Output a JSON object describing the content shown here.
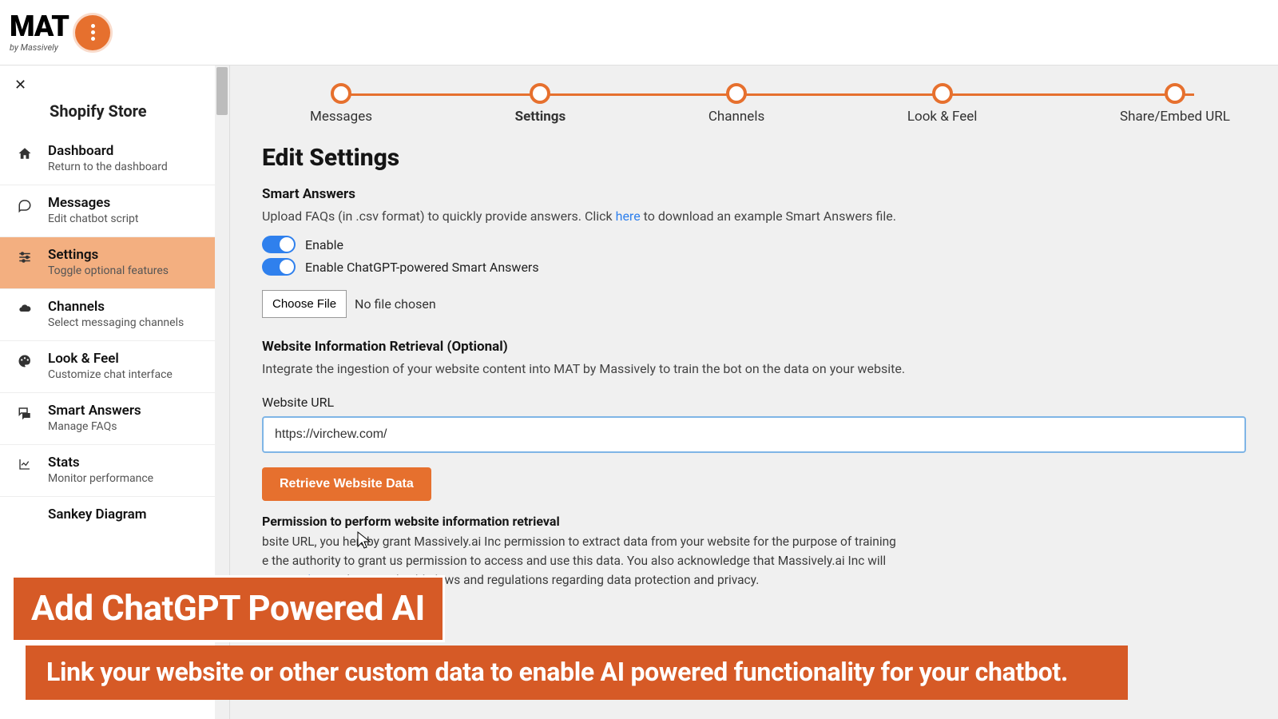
{
  "logo": {
    "main": "MAT",
    "sub": "by Massively"
  },
  "sidebar": {
    "store_title": "Shopify Store",
    "items": [
      {
        "title": "Dashboard",
        "sub": "Return to the dashboard"
      },
      {
        "title": "Messages",
        "sub": "Edit chatbot script"
      },
      {
        "title": "Settings",
        "sub": "Toggle optional features"
      },
      {
        "title": "Channels",
        "sub": "Select messaging channels"
      },
      {
        "title": "Look & Feel",
        "sub": "Customize chat interface"
      },
      {
        "title": "Smart Answers",
        "sub": "Manage FAQs"
      },
      {
        "title": "Stats",
        "sub": "Monitor performance"
      },
      {
        "title": "Sankey Diagram",
        "sub": ""
      }
    ]
  },
  "stepper": [
    {
      "label": "Messages",
      "bold": false
    },
    {
      "label": "Settings",
      "bold": true
    },
    {
      "label": "Channels",
      "bold": false
    },
    {
      "label": "Look & Feel",
      "bold": false
    },
    {
      "label": "Share/Embed URL",
      "bold": false
    }
  ],
  "main": {
    "page_title": "Edit Settings",
    "smart_answers_h": "Smart Answers",
    "smart_answers_desc_pre": "Upload FAQs (in .csv format) to quickly provide answers. Click ",
    "smart_answers_link": "here",
    "smart_answers_desc_post": " to download an example Smart Answers file.",
    "toggle1": "Enable",
    "toggle2": "Enable ChatGPT-powered Smart Answers",
    "choose_file": "Choose File",
    "file_status": "No file chosen",
    "wir_h": "Website Information Retrieval (Optional)",
    "wir_desc": "Integrate the ingestion of your website content into MAT by Massively to train the bot on the data on your website.",
    "url_label": "Website URL",
    "url_value": "https://virchew.com/",
    "retrieve_btn": "Retrieve Website Data",
    "perm_h": "Permission to perform website information retrieval",
    "perm_body1": "bsite URL, you hereby grant Massively.ai Inc permission to extract data from your website for the purpose of training",
    "perm_body2": "e the authority to grant us permission to access and use this data. You also acknowledge that Massively.ai Inc will",
    "perm_link": "ivacy Policy",
    "perm_body3": " and any applicable laws and regulations regarding data protection and privacy."
  },
  "banner": {
    "top": "Add ChatGPT Powered AI",
    "bottom": "Link your website or other custom data to enable AI powered functionality for your chatbot."
  }
}
